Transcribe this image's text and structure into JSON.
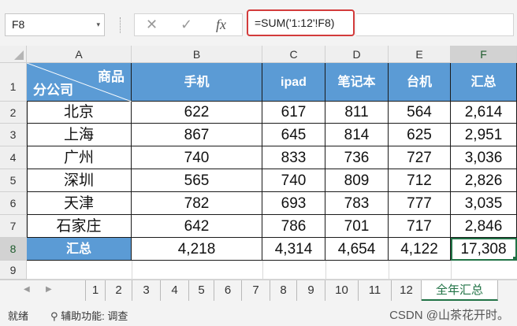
{
  "formula_bar": {
    "name_box": "F8",
    "name_box_dropdown": "▾",
    "cancel_icon": "✕",
    "enter_icon": "✓",
    "fx_icon": "fx",
    "formula": "=SUM('1:12'!F8)"
  },
  "columns": [
    "A",
    "B",
    "C",
    "D",
    "E",
    "F"
  ],
  "rows": [
    "1",
    "2",
    "3",
    "4",
    "5",
    "6",
    "7",
    "8",
    "9"
  ],
  "header": {
    "diag_top": "商品",
    "diag_bottom": "分公司",
    "products": [
      "手机",
      "ipad",
      "笔记本",
      "台机",
      "汇总"
    ]
  },
  "data_rows": [
    {
      "branch": "北京",
      "values": [
        "622",
        "617",
        "811",
        "564",
        "2,614"
      ]
    },
    {
      "branch": "上海",
      "values": [
        "867",
        "645",
        "814",
        "625",
        "2,951"
      ]
    },
    {
      "branch": "广州",
      "values": [
        "740",
        "833",
        "736",
        "727",
        "3,036"
      ]
    },
    {
      "branch": "深圳",
      "values": [
        "565",
        "740",
        "809",
        "712",
        "2,826"
      ]
    },
    {
      "branch": "天津",
      "values": [
        "782",
        "693",
        "783",
        "777",
        "3,035"
      ]
    },
    {
      "branch": "石家庄",
      "values": [
        "642",
        "786",
        "701",
        "717",
        "2,846"
      ]
    }
  ],
  "total_row": {
    "label": "汇总",
    "values": [
      "4,218",
      "4,314",
      "4,654",
      "4,122",
      "17,308"
    ]
  },
  "selected_cell": "F8",
  "sheet_tabs": [
    "1",
    "2",
    "3",
    "4",
    "5",
    "6",
    "7",
    "8",
    "9",
    "10",
    "11",
    "12",
    "全年汇总"
  ],
  "active_tab": "全年汇总",
  "tab_nav": {
    "prev": "◀",
    "next": "▶"
  },
  "status": {
    "ready": "就绪",
    "accessibility": "辅助功能: 调查"
  },
  "watermark": "CSDN @山茶花开时。",
  "colors": {
    "header_fill": "#5b9bd5",
    "selection": "#217346",
    "formula_highlight": "#d33b3b"
  }
}
